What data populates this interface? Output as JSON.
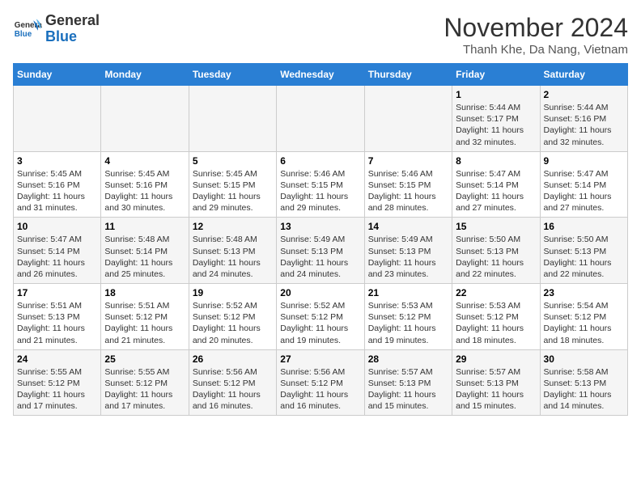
{
  "header": {
    "logo_general": "General",
    "logo_blue": "Blue",
    "month_title": "November 2024",
    "location": "Thanh Khe, Da Nang, Vietnam"
  },
  "weekdays": [
    "Sunday",
    "Monday",
    "Tuesday",
    "Wednesday",
    "Thursday",
    "Friday",
    "Saturday"
  ],
  "weeks": [
    [
      {
        "day": "",
        "info": ""
      },
      {
        "day": "",
        "info": ""
      },
      {
        "day": "",
        "info": ""
      },
      {
        "day": "",
        "info": ""
      },
      {
        "day": "",
        "info": ""
      },
      {
        "day": "1",
        "info": "Sunrise: 5:44 AM\nSunset: 5:17 PM\nDaylight: 11 hours\nand 32 minutes."
      },
      {
        "day": "2",
        "info": "Sunrise: 5:44 AM\nSunset: 5:16 PM\nDaylight: 11 hours\nand 32 minutes."
      }
    ],
    [
      {
        "day": "3",
        "info": "Sunrise: 5:45 AM\nSunset: 5:16 PM\nDaylight: 11 hours\nand 31 minutes."
      },
      {
        "day": "4",
        "info": "Sunrise: 5:45 AM\nSunset: 5:16 PM\nDaylight: 11 hours\nand 30 minutes."
      },
      {
        "day": "5",
        "info": "Sunrise: 5:45 AM\nSunset: 5:15 PM\nDaylight: 11 hours\nand 29 minutes."
      },
      {
        "day": "6",
        "info": "Sunrise: 5:46 AM\nSunset: 5:15 PM\nDaylight: 11 hours\nand 29 minutes."
      },
      {
        "day": "7",
        "info": "Sunrise: 5:46 AM\nSunset: 5:15 PM\nDaylight: 11 hours\nand 28 minutes."
      },
      {
        "day": "8",
        "info": "Sunrise: 5:47 AM\nSunset: 5:14 PM\nDaylight: 11 hours\nand 27 minutes."
      },
      {
        "day": "9",
        "info": "Sunrise: 5:47 AM\nSunset: 5:14 PM\nDaylight: 11 hours\nand 27 minutes."
      }
    ],
    [
      {
        "day": "10",
        "info": "Sunrise: 5:47 AM\nSunset: 5:14 PM\nDaylight: 11 hours\nand 26 minutes."
      },
      {
        "day": "11",
        "info": "Sunrise: 5:48 AM\nSunset: 5:14 PM\nDaylight: 11 hours\nand 25 minutes."
      },
      {
        "day": "12",
        "info": "Sunrise: 5:48 AM\nSunset: 5:13 PM\nDaylight: 11 hours\nand 24 minutes."
      },
      {
        "day": "13",
        "info": "Sunrise: 5:49 AM\nSunset: 5:13 PM\nDaylight: 11 hours\nand 24 minutes."
      },
      {
        "day": "14",
        "info": "Sunrise: 5:49 AM\nSunset: 5:13 PM\nDaylight: 11 hours\nand 23 minutes."
      },
      {
        "day": "15",
        "info": "Sunrise: 5:50 AM\nSunset: 5:13 PM\nDaylight: 11 hours\nand 22 minutes."
      },
      {
        "day": "16",
        "info": "Sunrise: 5:50 AM\nSunset: 5:13 PM\nDaylight: 11 hours\nand 22 minutes."
      }
    ],
    [
      {
        "day": "17",
        "info": "Sunrise: 5:51 AM\nSunset: 5:13 PM\nDaylight: 11 hours\nand 21 minutes."
      },
      {
        "day": "18",
        "info": "Sunrise: 5:51 AM\nSunset: 5:12 PM\nDaylight: 11 hours\nand 21 minutes."
      },
      {
        "day": "19",
        "info": "Sunrise: 5:52 AM\nSunset: 5:12 PM\nDaylight: 11 hours\nand 20 minutes."
      },
      {
        "day": "20",
        "info": "Sunrise: 5:52 AM\nSunset: 5:12 PM\nDaylight: 11 hours\nand 19 minutes."
      },
      {
        "day": "21",
        "info": "Sunrise: 5:53 AM\nSunset: 5:12 PM\nDaylight: 11 hours\nand 19 minutes."
      },
      {
        "day": "22",
        "info": "Sunrise: 5:53 AM\nSunset: 5:12 PM\nDaylight: 11 hours\nand 18 minutes."
      },
      {
        "day": "23",
        "info": "Sunrise: 5:54 AM\nSunset: 5:12 PM\nDaylight: 11 hours\nand 18 minutes."
      }
    ],
    [
      {
        "day": "24",
        "info": "Sunrise: 5:55 AM\nSunset: 5:12 PM\nDaylight: 11 hours\nand 17 minutes."
      },
      {
        "day": "25",
        "info": "Sunrise: 5:55 AM\nSunset: 5:12 PM\nDaylight: 11 hours\nand 17 minutes."
      },
      {
        "day": "26",
        "info": "Sunrise: 5:56 AM\nSunset: 5:12 PM\nDaylight: 11 hours\nand 16 minutes."
      },
      {
        "day": "27",
        "info": "Sunrise: 5:56 AM\nSunset: 5:12 PM\nDaylight: 11 hours\nand 16 minutes."
      },
      {
        "day": "28",
        "info": "Sunrise: 5:57 AM\nSunset: 5:13 PM\nDaylight: 11 hours\nand 15 minutes."
      },
      {
        "day": "29",
        "info": "Sunrise: 5:57 AM\nSunset: 5:13 PM\nDaylight: 11 hours\nand 15 minutes."
      },
      {
        "day": "30",
        "info": "Sunrise: 5:58 AM\nSunset: 5:13 PM\nDaylight: 11 hours\nand 14 minutes."
      }
    ]
  ]
}
